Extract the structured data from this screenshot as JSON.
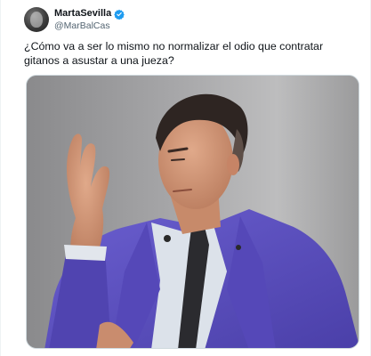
{
  "tweet": {
    "author": {
      "display_name": "MartaSevilla",
      "handle": "@MarBalCas",
      "verified": true,
      "verified_color": "#1d9bf0"
    },
    "text": "¿Cómo va a ser lo mismo no normalizar el odio que contratar  gitanos a asustar a una jueza?",
    "media": {
      "type": "photo",
      "alt": ""
    }
  },
  "colors": {
    "text_primary": "#0f1419",
    "text_secondary": "#536471",
    "suit": "#5a4fbf",
    "background_photo": "#a4a4a6"
  }
}
